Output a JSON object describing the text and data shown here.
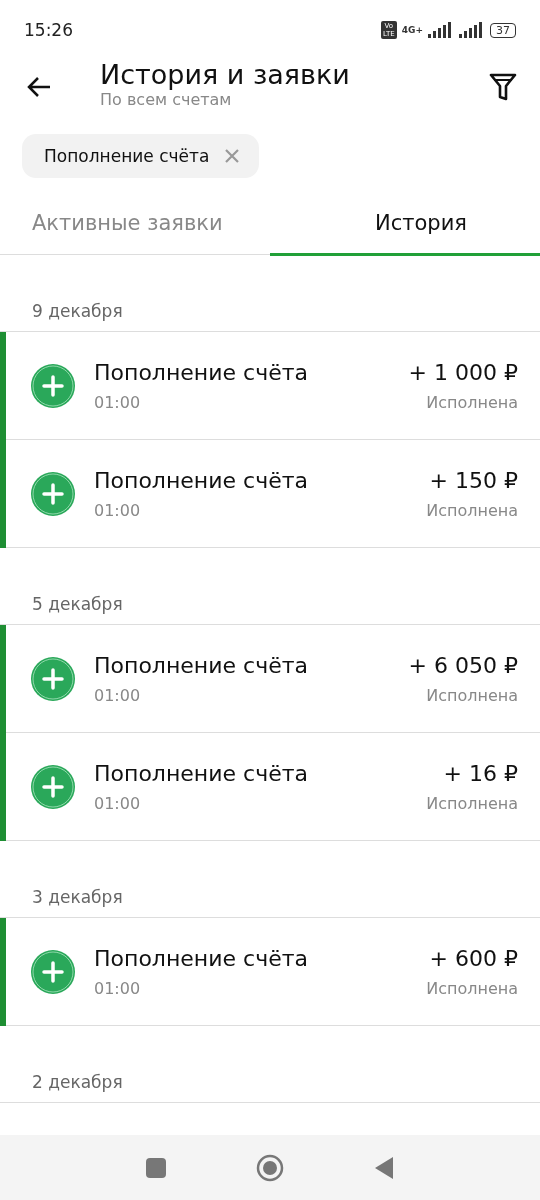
{
  "status_bar": {
    "time": "15:26",
    "volte": "Vo LTE",
    "network": "4G+",
    "battery": "37"
  },
  "header": {
    "title": "История и заявки",
    "subtitle": "По всем счетам"
  },
  "filter_chip": {
    "label": "Пополнение счёта"
  },
  "tabs": [
    {
      "label": "Активные заявки",
      "selected": false
    },
    {
      "label": "История",
      "selected": true
    }
  ],
  "groups": [
    {
      "date": "9 декабря",
      "rows": [
        {
          "title": "Пополнение счёта",
          "time": "01:00",
          "amount": "+ 1 000 ₽",
          "status": "Исполнена"
        },
        {
          "title": "Пополнение счёта",
          "time": "01:00",
          "amount": "+ 150 ₽",
          "status": "Исполнена"
        }
      ]
    },
    {
      "date": "5 декабря",
      "rows": [
        {
          "title": "Пополнение счёта",
          "time": "01:00",
          "amount": "+ 6 050 ₽",
          "status": "Исполнена"
        },
        {
          "title": "Пополнение счёта",
          "time": "01:00",
          "amount": "+ 16 ₽",
          "status": "Исполнена"
        }
      ]
    },
    {
      "date": "3 декабря",
      "rows": [
        {
          "title": "Пополнение счёта",
          "time": "01:00",
          "amount": "+ 600 ₽",
          "status": "Исполнена"
        }
      ]
    },
    {
      "date": "2 декабря"
    }
  ]
}
